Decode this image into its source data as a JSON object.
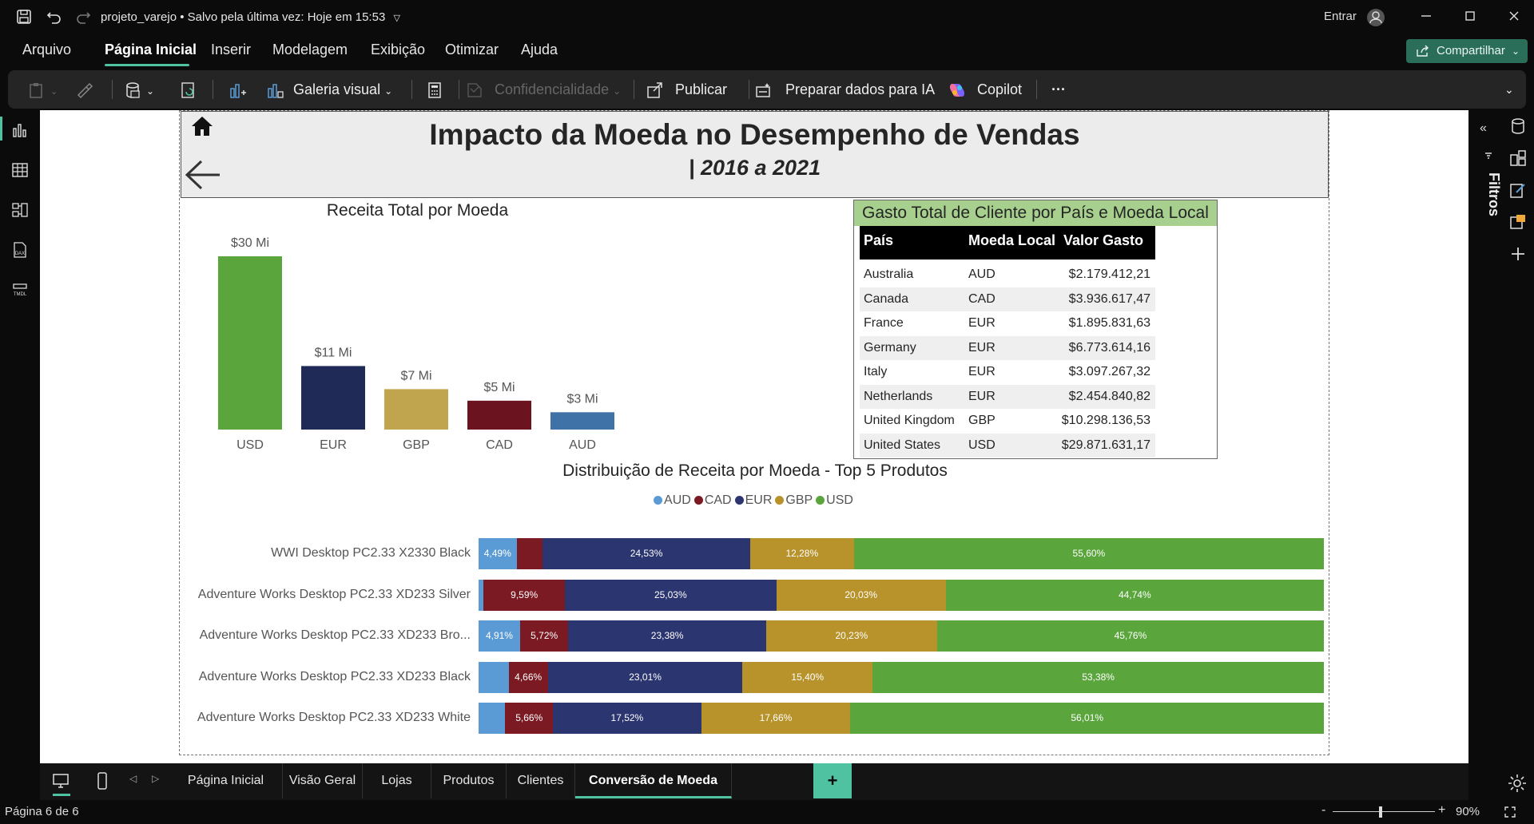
{
  "titlebar": {
    "filename": "projeto_varejo",
    "saved": "Salvo pela última vez: Hoje em 15:53",
    "signin": "Entrar"
  },
  "menu": {
    "items": [
      "Arquivo",
      "Página Inicial",
      "Inserir",
      "Modelagem",
      "Exibição",
      "Otimizar",
      "Ajuda"
    ],
    "active": "Página Inicial",
    "share": "Compartilhar"
  },
  "ribbon": {
    "gallery": "Galeria visual",
    "confidentiality": "Confidencialidade",
    "publish": "Publicar",
    "prepare_ai": "Preparar dados para IA",
    "copilot": "Copilot",
    "more": "···"
  },
  "filters": {
    "label": "Filtros"
  },
  "report": {
    "title": "Impacto da Moeda no Desempenho de Vendas",
    "subtitle": "| 2016 a 2021",
    "bar_chart_title": "Receita Total por Moeda",
    "table_title": "Gasto Total de Cliente por País e Moeda Local",
    "stacked_title": "Distribuição de Receita por Moeda - Top 5 Produtos"
  },
  "table": {
    "headers": [
      "País",
      "Moeda Local",
      "Valor Gasto"
    ],
    "rows": [
      [
        "Australia",
        "AUD",
        "$2.179.412,21"
      ],
      [
        "Canada",
        "CAD",
        "$3.936.617,47"
      ],
      [
        "France",
        "EUR",
        "$1.895.831,63"
      ],
      [
        "Germany",
        "EUR",
        "$6.773.614,16"
      ],
      [
        "Italy",
        "EUR",
        "$3.097.267,32"
      ],
      [
        "Netherlands",
        "EUR",
        "$2.454.840,82"
      ],
      [
        "United Kingdom",
        "GBP",
        "$10.298.136,53"
      ],
      [
        "United States",
        "USD",
        "$29.871.631,17"
      ]
    ]
  },
  "chart_data": [
    {
      "type": "bar",
      "title": "Receita Total por Moeda",
      "categories": [
        "USD",
        "EUR",
        "GBP",
        "CAD",
        "AUD"
      ],
      "values": [
        30,
        11,
        7,
        5,
        3
      ],
      "value_labels": [
        "$30 Mi",
        "$11 Mi",
        "$7 Mi",
        "$5 Mi",
        "$3 Mi"
      ],
      "colors": [
        "#5aa63c",
        "#1f2a56",
        "#c0a44e",
        "#6b1420",
        "#3f72a6"
      ]
    },
    {
      "type": "bar",
      "orientation": "horizontal-stacked-100",
      "title": "Distribuição de Receita por Moeda - Top 5 Produtos",
      "categories": [
        "WWI Desktop PC2.33 X2330 Black",
        "Adventure Works Desktop PC2.33 XD233 Silver",
        "Adventure Works Desktop PC2.33 XD233 Bro...",
        "Adventure Works Desktop PC2.33 XD233 Black",
        "Adventure Works Desktop PC2.33 XD233 White"
      ],
      "legend": [
        "AUD",
        "CAD",
        "EUR",
        "GBP",
        "USD"
      ],
      "colors": [
        "#5b9bd5",
        "#7b1a22",
        "#2b3570",
        "#b8922a",
        "#5aa63c"
      ],
      "series": [
        {
          "name": "AUD",
          "values": [
            4.49,
            0.61,
            4.91,
            3.55,
            3.15
          ],
          "labels": [
            "4,49%",
            "",
            "4,91%",
            "",
            ""
          ]
        },
        {
          "name": "CAD",
          "values": [
            3.1,
            9.59,
            5.72,
            4.66,
            5.66
          ],
          "labels": [
            "",
            "9,59%",
            "5,72%",
            "4,66%",
            "5,66%"
          ]
        },
        {
          "name": "EUR",
          "values": [
            24.53,
            25.03,
            23.38,
            23.01,
            17.52
          ],
          "labels": [
            "24,53%",
            "25,03%",
            "23,38%",
            "23,01%",
            "17,52%"
          ]
        },
        {
          "name": "GBP",
          "values": [
            12.28,
            20.03,
            20.23,
            15.4,
            17.66
          ],
          "labels": [
            "12,28%",
            "20,03%",
            "20,23%",
            "15,40%",
            "17,66%"
          ]
        },
        {
          "name": "USD",
          "values": [
            55.6,
            44.74,
            45.76,
            53.38,
            56.01
          ],
          "labels": [
            "55,60%",
            "44,74%",
            "45,76%",
            "53,38%",
            "56,01%"
          ]
        }
      ]
    }
  ],
  "pages": {
    "tabs": [
      "Página Inicial",
      "Visão Geral",
      "Lojas",
      "Produtos",
      "Clientes",
      "Conversão de Moeda"
    ],
    "active": "Conversão de Moeda",
    "add": "+"
  },
  "status": {
    "page": "Página 6 de 6",
    "zoom": "90%",
    "zoom_level": 90
  }
}
